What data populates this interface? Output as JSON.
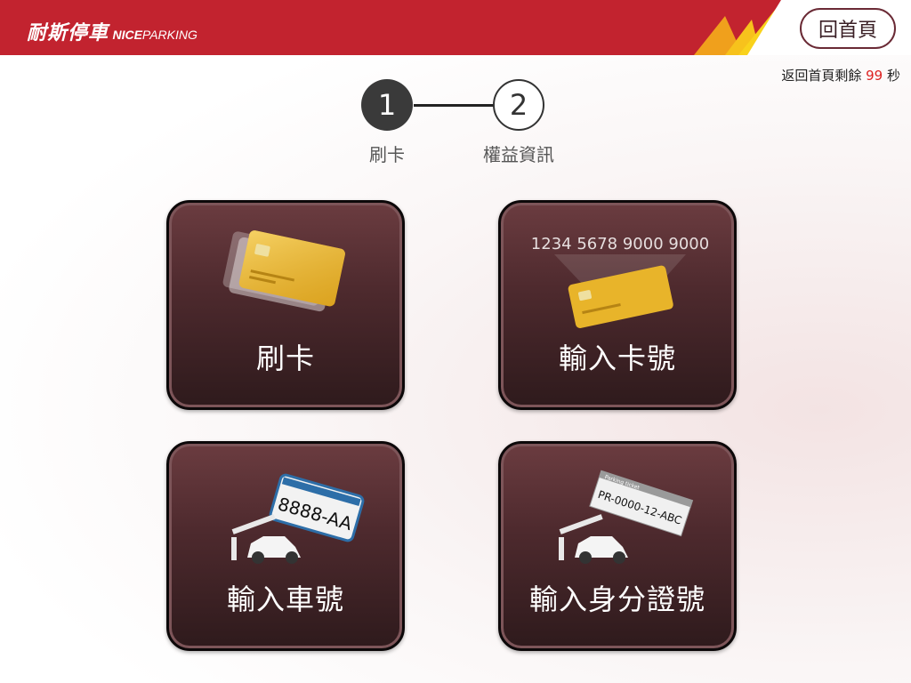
{
  "header": {
    "brand_zh": "耐斯停車",
    "brand_en_bold": "NICE",
    "brand_en": "PARKING",
    "home_button": "回首頁"
  },
  "countdown": {
    "prefix": "返回首頁剩餘",
    "seconds": "99",
    "suffix": "秒"
  },
  "steps": [
    {
      "number": "1",
      "label": "刷卡",
      "active": true
    },
    {
      "number": "2",
      "label": "權益資訊",
      "active": false
    }
  ],
  "options": {
    "swipe": {
      "label": "刷卡"
    },
    "card_number": {
      "label": "輸入卡號",
      "sample_number": "1234 5678 9000 9000"
    },
    "plate": {
      "label": "輸入車號",
      "plate_text": "8888-AA"
    },
    "id_number": {
      "label": "輸入身分證號",
      "ticket_header": "Parking ticket",
      "ticket_text": "PR-0000-12-ABC"
    }
  },
  "colors": {
    "header_red": "#c2232f",
    "accent_yellow": "#f5c21c",
    "countdown_number": "#dd2222",
    "tile_dark": "#2e1a1c"
  }
}
